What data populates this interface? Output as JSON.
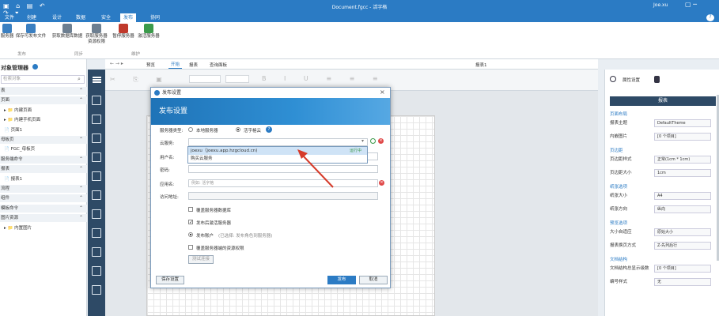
{
  "window": {
    "title": "Document.fgcc - 活字格",
    "user": "Joe.xu",
    "help": "?"
  },
  "menu": [
    "文件",
    "创建",
    "设计",
    "数据",
    "安全",
    "发布",
    "协同"
  ],
  "ribbon": {
    "buttons": [
      {
        "label": "服务器",
        "icon": "server-icon",
        "color": "#3a7fc1"
      },
      {
        "label": "保存可发布文件",
        "icon": "save-publish-icon",
        "color": "#3a7fc1"
      },
      {
        "label": "获取数据库数据",
        "icon": "database-download-icon",
        "color": "#6d7f91"
      },
      {
        "label": "获取服务器资源权限",
        "icon": "resource-permission-icon",
        "color": "#6d7f91"
      },
      {
        "label": "暂停服务器",
        "icon": "pause-server-icon",
        "color": "#c0392b"
      },
      {
        "label": "激活服务器",
        "icon": "activate-server-icon",
        "color": "#3b9a4b"
      }
    ],
    "groups": [
      "发布",
      "同步",
      "维护"
    ]
  },
  "left_panel": {
    "title": "对象管理器",
    "search_placeholder": "检索对象",
    "rows": [
      {
        "text": "表",
        "type": "section"
      },
      {
        "text": "页面",
        "type": "section"
      },
      {
        "text": "▸ 📁 内建页面",
        "type": "item"
      },
      {
        "text": "▸ 📁 内建手机页面",
        "type": "item"
      },
      {
        "text": "📄 页面1",
        "type": "item"
      },
      {
        "text": "母板页",
        "type": "section"
      },
      {
        "text": "📄 FGC_母板页",
        "type": "item"
      },
      {
        "text": "服务端命令",
        "type": "section"
      },
      {
        "text": "报表",
        "type": "section"
      },
      {
        "text": "📄 报表1",
        "type": "item"
      },
      {
        "text": "流程",
        "type": "section"
      },
      {
        "text": "组件",
        "type": "section"
      },
      {
        "text": "模板命令",
        "type": "section"
      },
      {
        "text": "图片资源",
        "type": "section"
      },
      {
        "text": "▸ 📁 内置图片",
        "type": "item"
      }
    ]
  },
  "doc_tabs": {
    "items": [
      "预览",
      "开始",
      "报表",
      "查询面板"
    ],
    "active": "开始",
    "doc_name": "报表1"
  },
  "right_panel": {
    "tabs": [
      "属性设置"
    ],
    "report_btn": "报表",
    "sections": [
      {
        "head": "页面布局",
        "rows": [
          {
            "label": "报表主题",
            "value": "DefaultTheme"
          },
          {
            "label": "内嵌图片",
            "value": "[0 个项目]"
          }
        ]
      },
      {
        "head": "页边距",
        "rows": [
          {
            "label": "页边距样式",
            "value": "正常(1cm * 1cm)"
          },
          {
            "label": "页边距大小",
            "value": "1cm"
          }
        ]
      },
      {
        "head": "纸张选项",
        "rows": [
          {
            "label": "纸张大小",
            "value": "A4"
          },
          {
            "label": "纸张方向",
            "value": "纵向"
          }
        ]
      },
      {
        "head": "预览选项",
        "rows": [
          {
            "label": "大小自适应",
            "value": "原始大小"
          },
          {
            "label": "报表换页方式",
            "value": "Z-先列后行"
          }
        ]
      },
      {
        "head": "文档结构",
        "rows": [
          {
            "label": "文档结构总显示级数",
            "value": "[0 个项目]"
          },
          {
            "label": "编号样式",
            "value": "无"
          }
        ]
      }
    ]
  },
  "dialog": {
    "title": "发布设置",
    "banner": "发布设置",
    "server_type_label": "服务器类型:",
    "opt_local": "本地服务器",
    "opt_cloud": "活字格云",
    "cloud_service_label": "云服务:",
    "cloud_service_value": "",
    "dropdown_items": [
      "joexu（joexu.app.hzgcloud.cn)",
      "购买云服务"
    ],
    "running_tag": "运行中",
    "username_label": "用户名:",
    "password_label": "密码:",
    "app_name_label": "应用名:",
    "app_name_placeholder": "例如: 活字格",
    "access_label": "访问地址:",
    "chk_overwrite_db": "覆盖服务器数据库",
    "chk_activate": "发布后激活服务器",
    "publish_account_label": "发布账户",
    "publish_account_hint": "(已选择: 发布角色到服务器)",
    "chk_overwrite_perm": "覆盖服务器端的资源权限",
    "test_btn": "测试连接",
    "save_btn": "保存设置",
    "publish_btn": "发布",
    "cancel_btn": "取消"
  }
}
